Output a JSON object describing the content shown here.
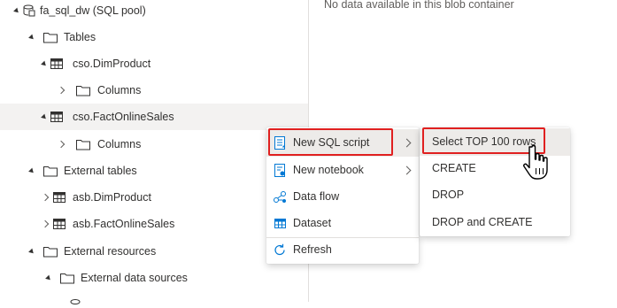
{
  "tree": {
    "items": [
      {
        "label": "fa_sql_dw (SQL pool)"
      },
      {
        "label": "Tables"
      },
      {
        "label": "cso.DimProduct"
      },
      {
        "label": "Columns"
      },
      {
        "label": "cso.FactOnlineSales"
      },
      {
        "label": "Columns"
      },
      {
        "label": "External tables"
      },
      {
        "label": "asb.DimProduct"
      },
      {
        "label": "asb.FactOnlineSales"
      },
      {
        "label": "External resources"
      },
      {
        "label": "External data sources"
      }
    ]
  },
  "blob_panel": {
    "empty_message": "No data available in this blob container"
  },
  "context_menu": {
    "items": [
      {
        "label": "New SQL script",
        "icon": "sql-script-icon"
      },
      {
        "label": "New notebook",
        "icon": "notebook-icon"
      },
      {
        "label": "Data flow",
        "icon": "data-flow-icon"
      },
      {
        "label": "Dataset",
        "icon": "dataset-icon"
      },
      {
        "label": "Refresh",
        "icon": "refresh-icon"
      }
    ]
  },
  "submenu": {
    "items": [
      {
        "label": "Select TOP 100 rows"
      },
      {
        "label": "CREATE"
      },
      {
        "label": "DROP"
      },
      {
        "label": "DROP and CREATE"
      }
    ]
  },
  "colors": {
    "accent": "#0078d4",
    "highlight_box": "#e02020",
    "hover_background": "#f3f2f1",
    "selected_background": "#edebe9"
  }
}
